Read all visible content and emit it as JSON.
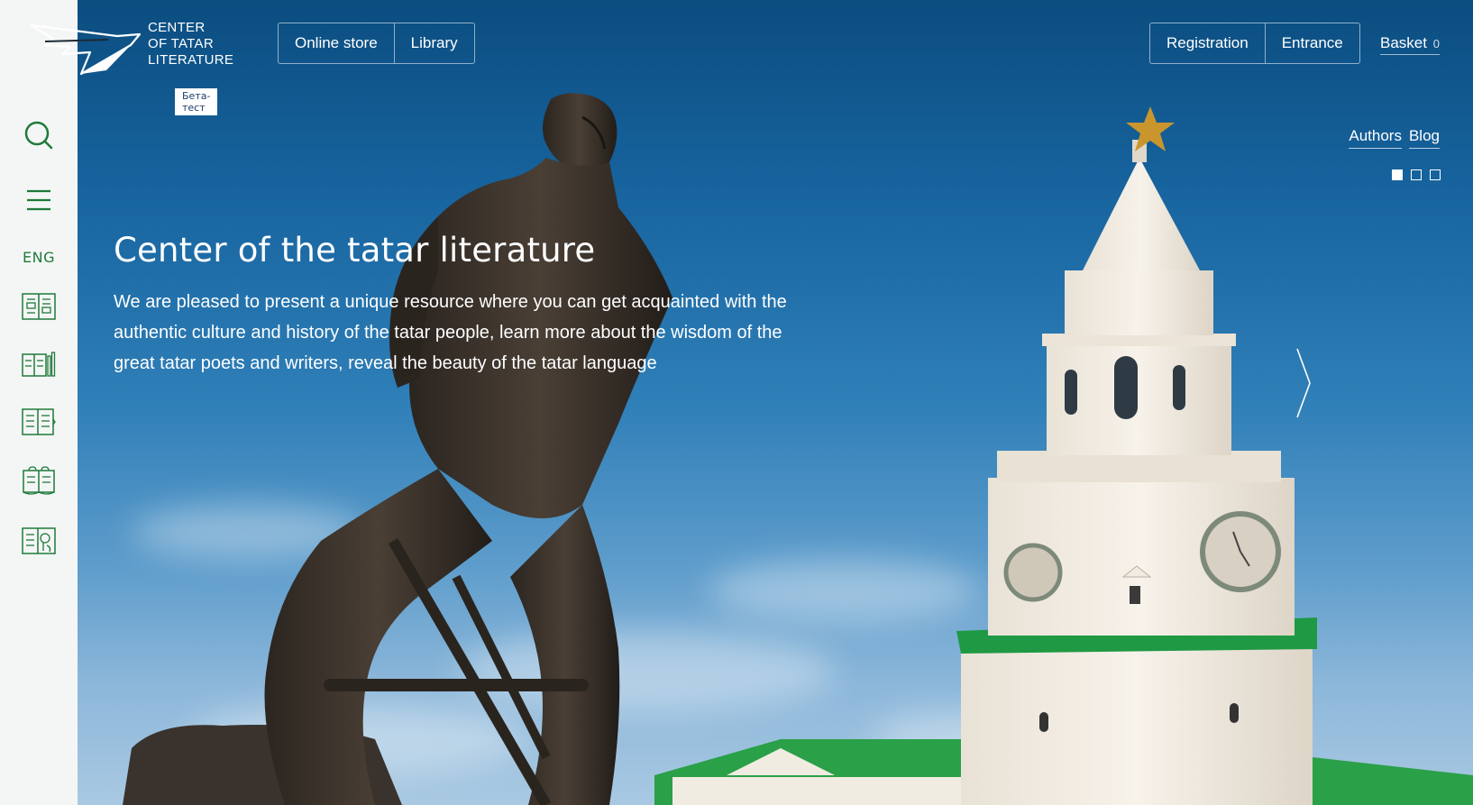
{
  "logo": {
    "lines": [
      "CENTER",
      "OF TATAR",
      "LITERATURE"
    ],
    "badge": "Бета-тест"
  },
  "sidebar": {
    "language": "ENG",
    "items": [
      {
        "icon": "search-icon"
      },
      {
        "icon": "menu-icon"
      },
      {
        "icon": "books-icon"
      },
      {
        "icon": "library-shelf-icon"
      },
      {
        "icon": "document-icon"
      },
      {
        "icon": "reading-icon"
      },
      {
        "icon": "audio-book-icon"
      }
    ]
  },
  "header": {
    "left_buttons": [
      "Online store",
      "Library"
    ],
    "right_buttons": [
      "Registration",
      "Entrance"
    ],
    "basket_label": "Basket",
    "basket_count": "0"
  },
  "sub_nav": [
    "Authors",
    "Blog"
  ],
  "slider": {
    "slide_count": 3,
    "active_index": 0
  },
  "hero": {
    "title": "Center of the tatar literature",
    "description": "We are pleased to present a unique resource where you can get acquainted with the authentic culture and history of the tatar people, learn more about the wisdom of the great tatar poets and writers, reveal the beauty of the tatar language"
  },
  "colors": {
    "accent_green": "#1f7a3a",
    "sidebar_bg": "#f4f6f5",
    "sky_top": "#0b4d80"
  }
}
